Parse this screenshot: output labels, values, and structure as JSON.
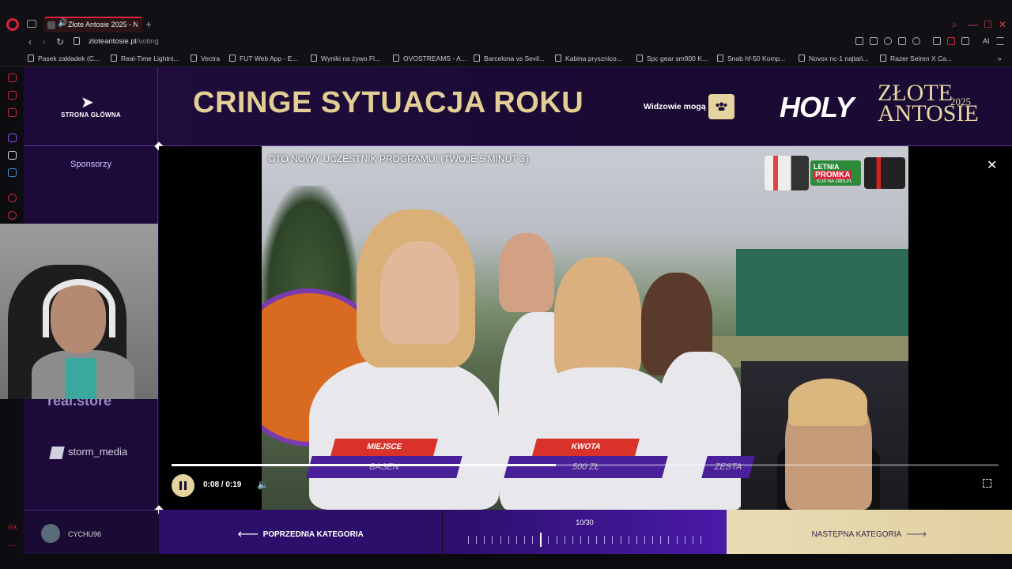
{
  "browser": {
    "tab_title": "Złote Antosie 2025 - N",
    "url_host": "zloteantosie.pl",
    "url_path": "/voting",
    "ai_label": "AI",
    "bookmarks": [
      "Pasek zakładek (C...",
      "Real-Time Lightni...",
      "Vectra",
      "FUT Web App - E...",
      "Wyniki na żywo Fl...",
      "OVOSTREAMS - A...",
      "Barcelona vs Sevil...",
      "Kabina prysznico...",
      "Spc gear sm900 K...",
      "Snab hf-50 Komp...",
      "Novox nc-1 najtań...",
      "Razer Seiren X Ca..."
    ]
  },
  "sidebar": {
    "back_label": "STRONA GŁÓWNA",
    "sponsors_label": "Sponsorzy",
    "sponsor_partial": "real.store",
    "sponsor_storm": "storm_media"
  },
  "header": {
    "category_title": "CRINGE SYTUACJA ROKU",
    "viewers_label": "Widzowie mogą",
    "logo_holy": "HOLY",
    "logo_zlote": "ZŁOTE",
    "logo_antosie": "ANTOSIE",
    "logo_year": "2025"
  },
  "video": {
    "title": "OTO NOWY UCZESTNIK PROGRAMU! (TWOJE 5 MINUT 3)",
    "ad_line1": "LETNIA",
    "ad_line2": "PROMKA",
    "ad_line3": "KUP NA OBS.PL",
    "overlay_labels": [
      "MIEJSCE",
      "KWOTA"
    ],
    "overlay_values": [
      "BASEN",
      "500 ZŁ",
      "ZESTA"
    ],
    "current_time": "0:08",
    "duration": "0:19",
    "time_display": "0:08 / 0:19",
    "progress": 0.465
  },
  "footer": {
    "username": "CYCHU96",
    "prev_label": "POPRZEDNIA KATEGORIA",
    "counter": "10/30",
    "current_index": 10,
    "total": 30,
    "next_label": "NASTĘPNA KATEGORIA"
  },
  "colors": {
    "accent_gold": "#e3cf95",
    "page_purple": "#1d0a3a",
    "opera_red": "#d8243a"
  }
}
